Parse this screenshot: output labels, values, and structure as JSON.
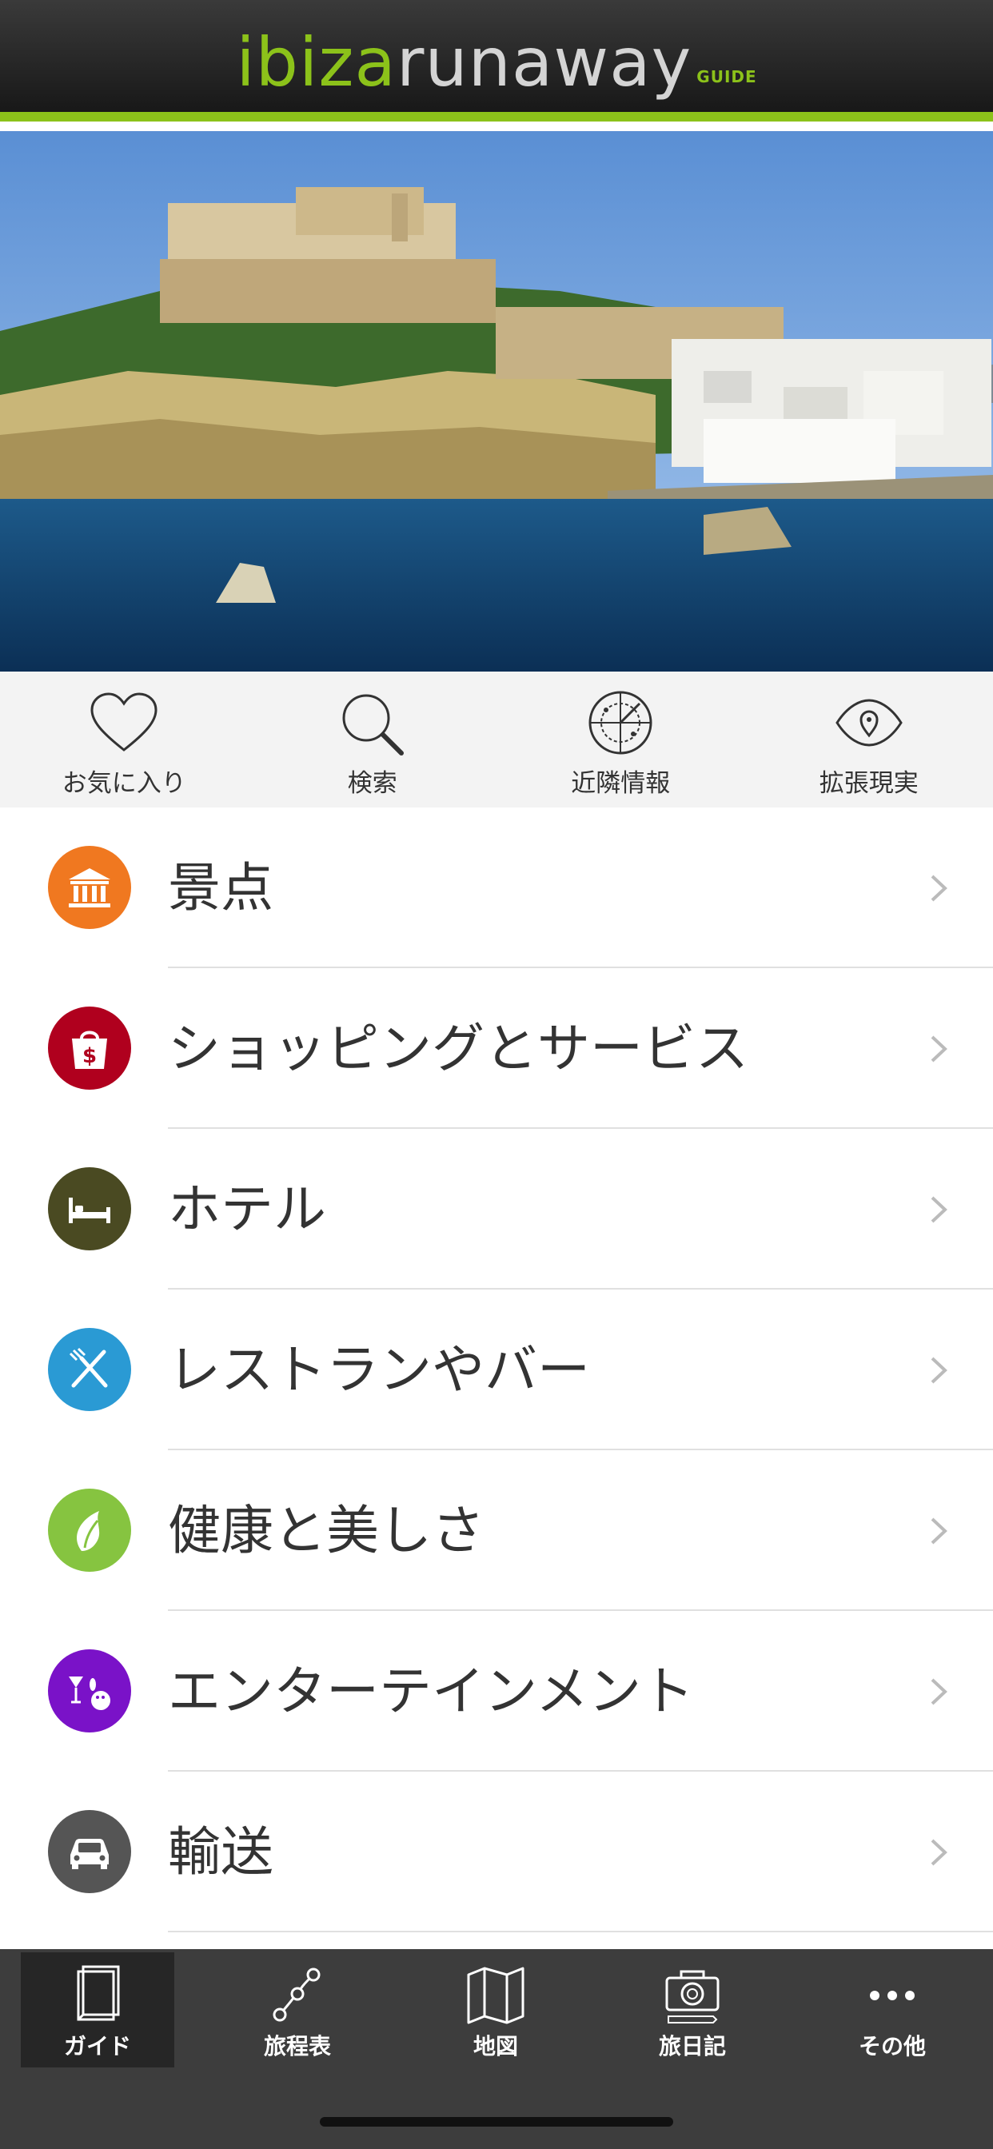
{
  "header": {
    "logo_part1": "ibiza",
    "logo_part2": "runaway",
    "logo_tag": "GUIDE",
    "accent": "#8cc21a"
  },
  "hero": {
    "image": "ibiza-dalt-vila-photo"
  },
  "quick_actions": [
    {
      "label": "お気に入り",
      "icon": "heart-icon"
    },
    {
      "label": "検索",
      "icon": "search-icon"
    },
    {
      "label": "近隣情報",
      "icon": "radar-icon"
    },
    {
      "label": "拡張現実",
      "icon": "eye-pin-icon"
    }
  ],
  "categories": [
    {
      "label": "景点",
      "icon": "landmark-icon",
      "color": "#f07820"
    },
    {
      "label": "ショッピングとサービス",
      "icon": "shopping-bag-icon",
      "color": "#b0001e"
    },
    {
      "label": "ホテル",
      "icon": "bed-icon",
      "color": "#4a4a22"
    },
    {
      "label": "レストランやバー",
      "icon": "fork-knife-icon",
      "color": "#2a9ad4"
    },
    {
      "label": "健康と美しさ",
      "icon": "leaf-icon",
      "color": "#86c440"
    },
    {
      "label": "エンターテインメント",
      "icon": "entertainment-icon",
      "color": "#7a12c8"
    },
    {
      "label": "輸送",
      "icon": "car-icon",
      "color": "#555555"
    }
  ],
  "tabs": [
    {
      "label": "ガイド",
      "icon": "guide-book-icon",
      "active": true
    },
    {
      "label": "旅程表",
      "icon": "route-icon",
      "active": false
    },
    {
      "label": "地図",
      "icon": "map-icon",
      "active": false
    },
    {
      "label": "旅日記",
      "icon": "camera-icon",
      "active": false
    },
    {
      "label": "その他",
      "icon": "more-icon",
      "active": false
    }
  ]
}
